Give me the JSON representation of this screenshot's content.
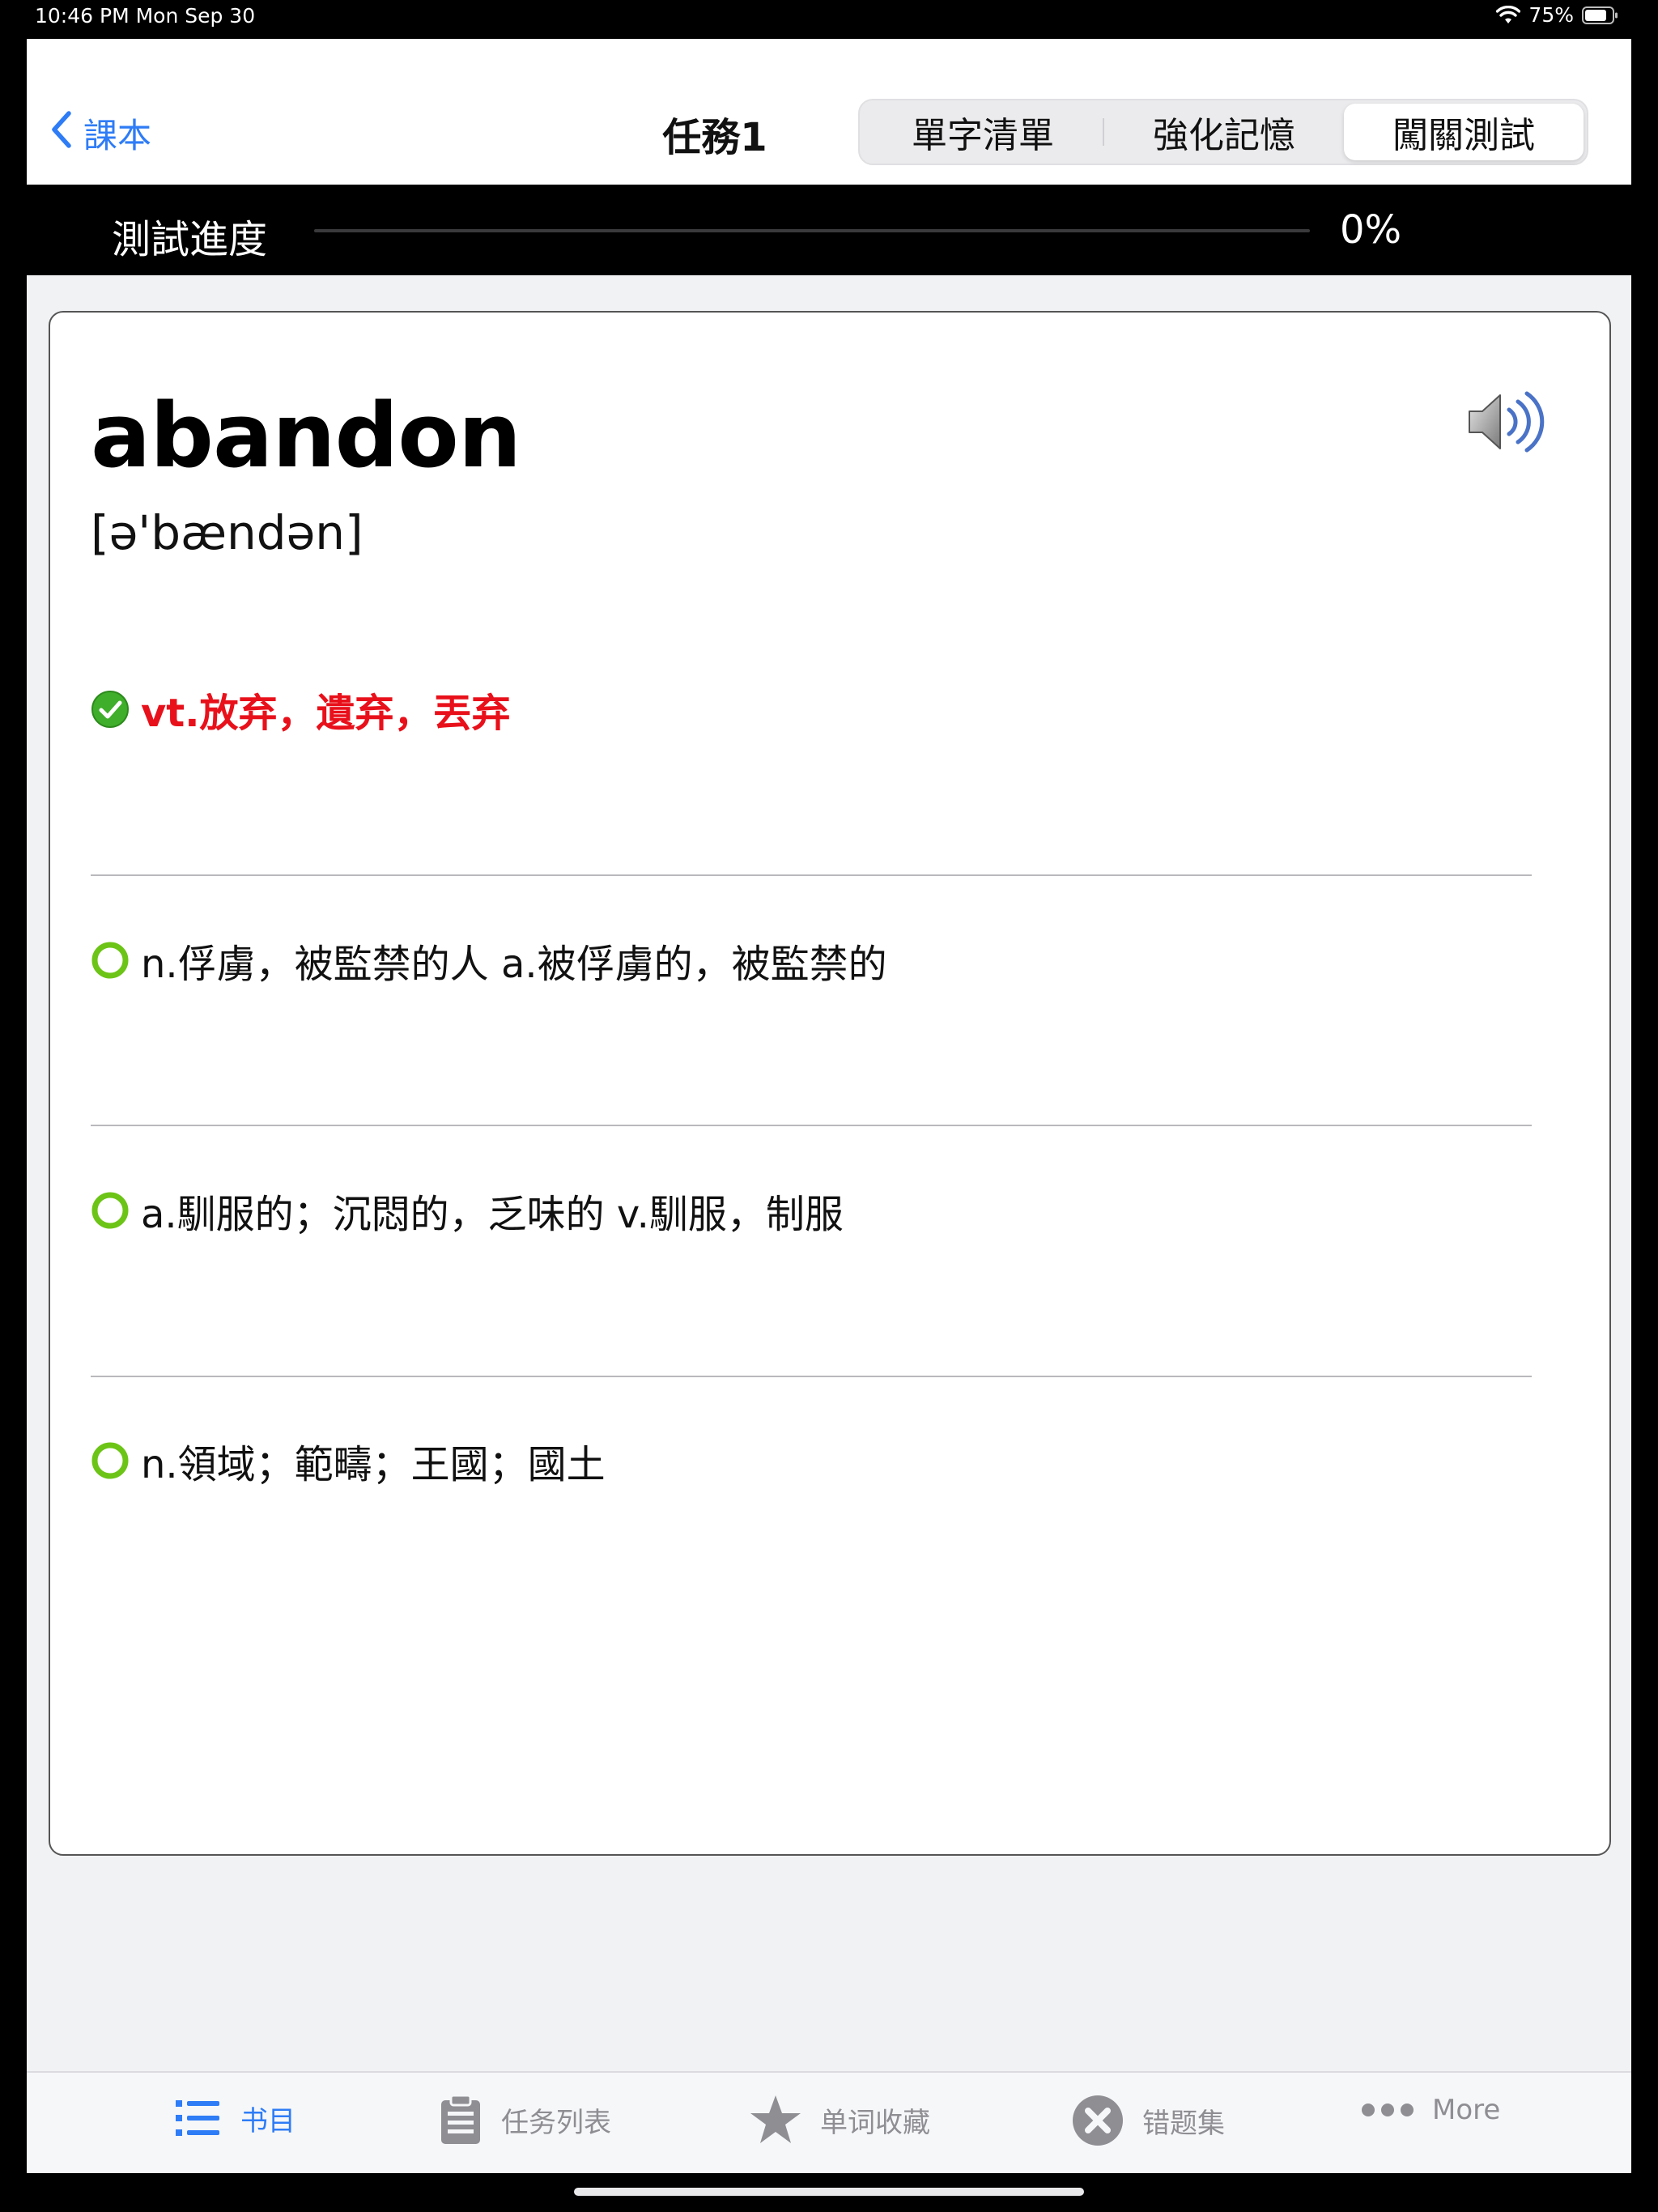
{
  "status_bar": {
    "time_date": "10:46 PM   Mon Sep 30",
    "battery": "75%"
  },
  "nav": {
    "back_label": "課本",
    "title": "任務1",
    "segments": [
      {
        "label": "單字清單",
        "selected": false
      },
      {
        "label": "強化記憶",
        "selected": false
      },
      {
        "label": "闖關測試",
        "selected": true
      }
    ]
  },
  "progress": {
    "label": "測試進度",
    "value": 0,
    "percent_text": "0%"
  },
  "card": {
    "word": "abandon",
    "phonetic": "[ə'bændən]",
    "options": [
      {
        "text": "vt.放弃，遺弃，丟弃",
        "state": "correct",
        "icon": "check-circle-icon"
      },
      {
        "text": "n.俘虜，被監禁的人 a.被俘虜的，被監禁的",
        "state": "unselected",
        "icon": "radio-circle-icon"
      },
      {
        "text": "a.馴服的；沉悶的，乏味的 v.馴服，制服",
        "state": "unselected",
        "icon": "radio-circle-icon"
      },
      {
        "text": "n.領域；範疇；王國；國土",
        "state": "unselected",
        "icon": "radio-circle-icon"
      }
    ]
  },
  "tab_bar": {
    "tabs": [
      {
        "label": "书目",
        "icon": "list-icon",
        "active": true
      },
      {
        "label": "任务列表",
        "icon": "clipboard-icon",
        "active": false
      },
      {
        "label": "单词收藏",
        "icon": "star-icon",
        "active": false
      },
      {
        "label": "错题集",
        "icon": "close-circle-icon",
        "active": false
      },
      {
        "label": "More",
        "icon": "more-icon",
        "active": false
      }
    ]
  },
  "colors": {
    "accent": "#2e7cf6",
    "correct_text": "#e8111b",
    "radio_green": "#6cc417"
  }
}
